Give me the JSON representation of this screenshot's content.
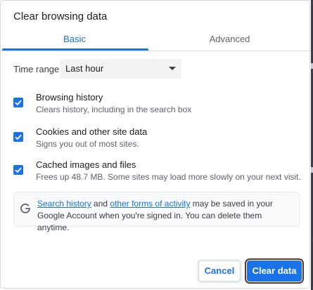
{
  "dialog": {
    "title": "Clear browsing data"
  },
  "tabs": [
    {
      "label": "Basic",
      "selected": true
    },
    {
      "label": "Advanced",
      "selected": false
    }
  ],
  "time_range": {
    "label": "Time range",
    "value": "Last hour"
  },
  "options": [
    {
      "title": "Browsing history",
      "subtitle": "Clears history, including in the search box",
      "checked": true
    },
    {
      "title": "Cookies and other site data",
      "subtitle": "Signs you out of most sites.",
      "checked": true
    },
    {
      "title": "Cached images and files",
      "subtitle": "Frees up 48.7 MB. Some sites may load more slowly on your next visit.",
      "checked": true
    }
  ],
  "info": {
    "link_search_history": "Search history",
    "text_and": " and ",
    "link_other_activity": "other forms of activity",
    "text_rest": " may be saved in your Google Account when you're signed in. You can delete them anytime."
  },
  "buttons": {
    "cancel": "Cancel",
    "clear": "Clear data"
  },
  "colors": {
    "accent": "#1a73e8",
    "text": "#202124",
    "secondary_text": "#5f6368"
  }
}
